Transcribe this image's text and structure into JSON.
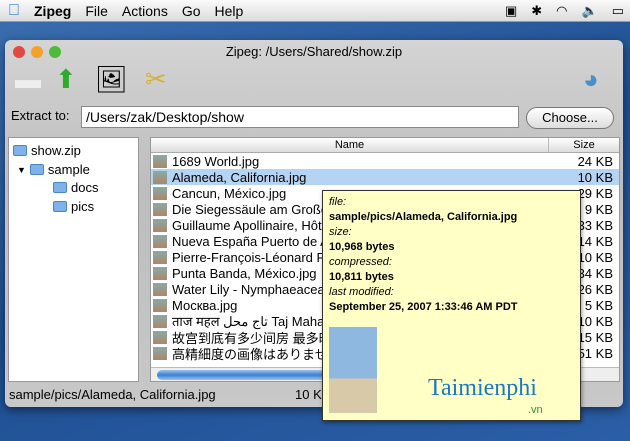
{
  "menubar": {
    "app": "Zipeg",
    "items": [
      "File",
      "Actions",
      "Go",
      "Help"
    ]
  },
  "window": {
    "title": "Zipeg: /Users/Shared/show.zip"
  },
  "extract": {
    "label": "Extract to:",
    "path": "/Users/zak/Desktop/show",
    "choose": "Choose..."
  },
  "tree": {
    "root": "show.zip",
    "sample": "sample",
    "docs": "docs",
    "pics": "pics"
  },
  "list": {
    "headers": {
      "name": "Name",
      "size": "Size"
    },
    "rows": [
      {
        "name": "1689 World.jpg",
        "size": "24 KB"
      },
      {
        "name": "Alameda, California.jpg",
        "size": "10 KB"
      },
      {
        "name": "Cancun, México.jpg",
        "size": "29 KB"
      },
      {
        "name": "Die Siegessäule am Großer",
        "size": "9 KB"
      },
      {
        "name": "Guillaume Apollinaire, Hôte",
        "size": "33 KB"
      },
      {
        "name": "Nueva España Puerto de A",
        "size": "14 KB"
      },
      {
        "name": "Pierre-François-Léonard F",
        "size": "10 KB"
      },
      {
        "name": "Punta Banda, México.jpg",
        "size": "34 KB"
      },
      {
        "name": "Water Lily - Nymphaeaceae",
        "size": "26 KB"
      },
      {
        "name": "Москва.jpg",
        "size": "5 KB"
      },
      {
        "name": "ताज महल تاج محل Taj Mahal.jpg",
        "size": "10 KB"
      },
      {
        "name": "故宫到底有多少间房 最多时",
        "size": "15 KB"
      },
      {
        "name": "高精細度の画像はありません",
        "size": "51 KB"
      }
    ]
  },
  "status": {
    "path": "sample/pics/Alameda, California.jpg",
    "size": "10 KB"
  },
  "tooltip": {
    "file_label": "file:",
    "file": "sample/pics/Alameda, California.jpg",
    "size_label": "size:",
    "size": "10,968 bytes",
    "compressed_label": "compressed:",
    "compressed": "10,811 bytes",
    "modified_label": "last modified:",
    "modified": "September 25, 2007 1:33:46 AM PDT"
  },
  "watermark": {
    "brand": "Taimienphi",
    "tld": ".vn"
  }
}
